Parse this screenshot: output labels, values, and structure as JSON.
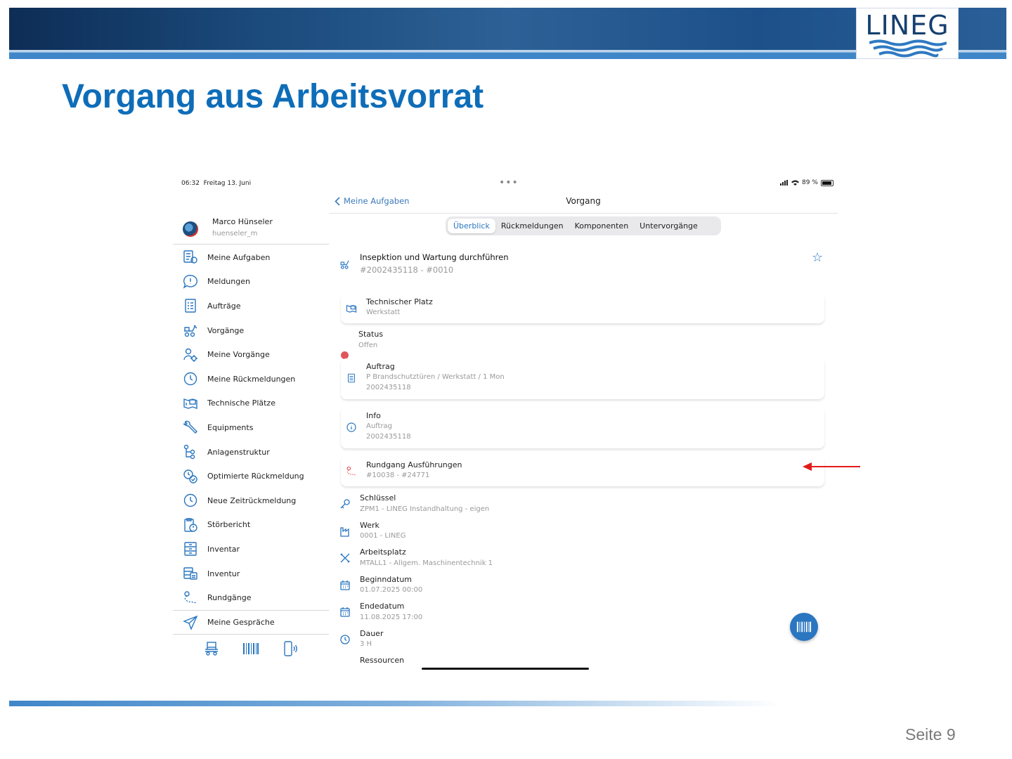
{
  "logo": {
    "text": "LINEG"
  },
  "slide": {
    "title": "Vorgang aus Arbeitsvorrat",
    "page": "Seite 9"
  },
  "statusbar": {
    "time": "06:32",
    "date": "Freitag 13. Juni",
    "battery": "89 %"
  },
  "user": {
    "name": "Marco Hünseler",
    "id": "huenseler_m"
  },
  "nav": [
    {
      "label": "Meine Aufgaben",
      "icon": "tasks-icon"
    },
    {
      "label": "Meldungen",
      "icon": "message-alert-icon"
    },
    {
      "label": "Aufträge",
      "icon": "order-list-icon"
    },
    {
      "label": "Vorgänge",
      "icon": "operations-icon"
    },
    {
      "label": "Meine Vorgänge",
      "icon": "my-operations-icon"
    },
    {
      "label": "Meine Rückmeldungen",
      "icon": "clock-icon"
    },
    {
      "label": "Technische Plätze",
      "icon": "functional-location-icon"
    },
    {
      "label": "Equipments",
      "icon": "wrench-icon"
    },
    {
      "label": "Anlagenstruktur",
      "icon": "hierarchy-icon"
    },
    {
      "label": "Optimierte Rückmeldung",
      "icon": "optimized-confirmation-icon"
    },
    {
      "label": "Neue Zeitrückmeldung",
      "icon": "clock-icon"
    },
    {
      "label": "Störbericht",
      "icon": "malfunction-report-icon"
    },
    {
      "label": "Inventar",
      "icon": "cabinet-icon"
    },
    {
      "label": "Inventur",
      "icon": "inventory-count-icon"
    },
    {
      "label": "Rundgänge",
      "icon": "route-icon"
    },
    {
      "label": "Meine Gespräche",
      "icon": "send-icon"
    }
  ],
  "bottom_icons": [
    "forklift-icon",
    "barcode-icon",
    "nfc-phone-icon"
  ],
  "pane": {
    "back_label": "Meine Aufgaben",
    "title": "Vorgang",
    "tabs": [
      "Überblick",
      "Rückmeldungen",
      "Komponenten",
      "Untervorgänge"
    ],
    "active_tab": "Überblick",
    "header": {
      "title": "Insepktion und Wartung durchführen",
      "subtitle": "#2002435118 - #0010"
    },
    "technischer_platz": {
      "label": "Technischer Platz",
      "value": "Werkstatt"
    },
    "status": {
      "label": "Status",
      "value": "Offen",
      "color": "#e0555a"
    },
    "auftrag": {
      "label": "Auftrag",
      "value1": "P Brandschutztüren / Werkstatt / 1 Mon",
      "value2": "2002435118"
    },
    "info": {
      "label": "Info",
      "value1": "Auftrag",
      "value2": "2002435118"
    },
    "rundgang": {
      "label": "Rundgang Ausführungen",
      "value": "#10038 - #24771"
    },
    "schluessel": {
      "label": "Schlüssel",
      "value": "ZPM1 - LINEG Instandhaltung - eigen"
    },
    "werk": {
      "label": "Werk",
      "value": "0001 - LINEG"
    },
    "arbeitsplatz": {
      "label": "Arbeitsplatz",
      "value": "MTALL1 - Allgem. Maschinentechnik 1"
    },
    "beginndatum": {
      "label": "Beginndatum",
      "value": "01.07.2025 00:00"
    },
    "endedatum": {
      "label": "Endedatum",
      "value": "11.08.2025 17:00"
    },
    "dauer": {
      "label": "Dauer",
      "value": "3 H"
    },
    "ressourcen": {
      "label": "Ressourcen"
    }
  },
  "colors": {
    "accent": "#2a76c0",
    "title_blue": "#0e6db8",
    "arrow": "#e31b1b"
  }
}
